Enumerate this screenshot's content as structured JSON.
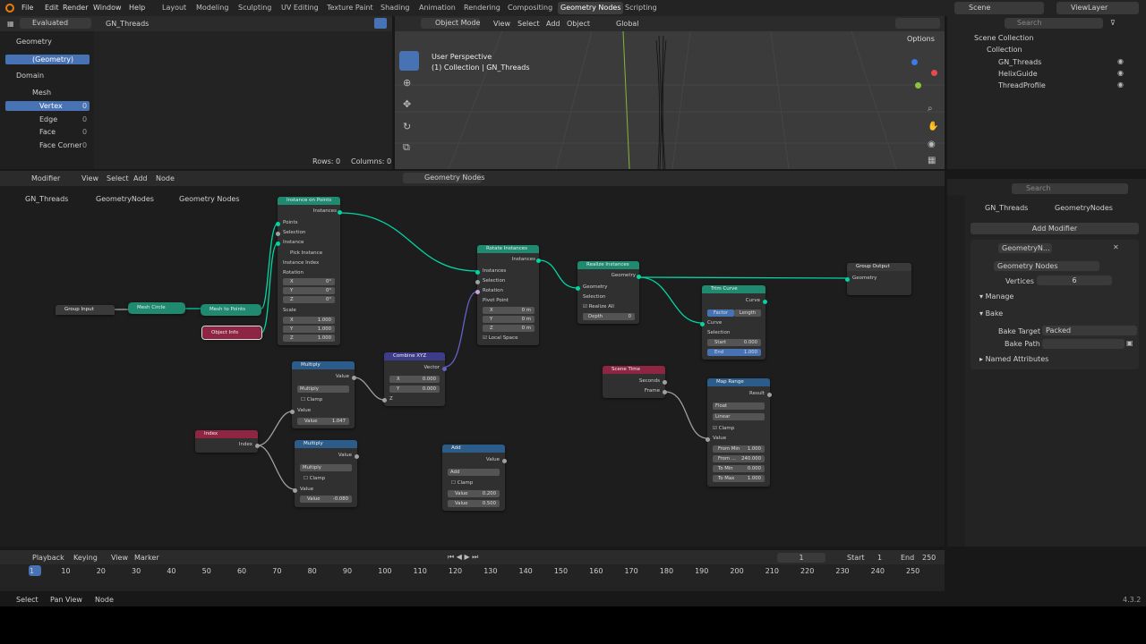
{
  "topbar": {
    "menus": [
      "File",
      "Edit",
      "Render",
      "Window",
      "Help"
    ],
    "workspaces": [
      "Layout",
      "Modeling",
      "Sculpting",
      "UV Editing",
      "Texture Paint",
      "Shading",
      "Animation",
      "Rendering",
      "Compositing",
      "Geometry Nodes",
      "Scripting"
    ],
    "active_workspace": "Geometry Nodes",
    "scene": "Scene",
    "view_layer": "ViewLayer"
  },
  "spreadsheet": {
    "mode": "Evaluated",
    "object": "GN_Threads",
    "tree": [
      "Geometry",
      "(Geometry)",
      "Domain",
      "Mesh",
      "Vertex",
      "Edge",
      "Face",
      "Face Corner"
    ],
    "counts": [
      "0",
      "0",
      "0",
      "0"
    ],
    "rows": "Rows: 0",
    "columns": "Columns: 0"
  },
  "viewport": {
    "mode": "Object Mode",
    "menus": [
      "View",
      "Select",
      "Add",
      "Object"
    ],
    "orientation": "Global",
    "title": "User Perspective",
    "subtitle": "(1) Collection | GN_Threads",
    "options": "Options"
  },
  "outliner": {
    "search": "Search",
    "items": [
      "Scene Collection",
      "Collection",
      "GN_Threads",
      "HelixGuide",
      "ThreadProfile"
    ]
  },
  "node_editor": {
    "editor": "Modifier",
    "menus": [
      "View",
      "Select",
      "Add",
      "Node"
    ],
    "tree_name": "Geometry Nodes",
    "breadcrumb": [
      "GN_Threads",
      "GeometryNodes",
      "Geometry Nodes"
    ]
  },
  "nodes": {
    "group_input": {
      "title": "Group Input"
    },
    "mesh_circle": {
      "title": "Mesh Circle"
    },
    "mesh_to_points": {
      "title": "Mesh to Points"
    },
    "object_info": {
      "title": "Object Info"
    },
    "instance_on_points": {
      "title": "Instance on Points",
      "out": "Instances",
      "rows": [
        "Points",
        "Selection",
        "Instance",
        "Pick Instance",
        "Instance Index",
        "Rotation"
      ],
      "rot": [
        "X",
        "0°",
        "Y",
        "0°",
        "Z",
        "0°"
      ],
      "scale": "Scale",
      "sc": [
        "X",
        "1.000",
        "Y",
        "1.000",
        "Z",
        "1.000"
      ]
    },
    "rotate_instances": {
      "title": "Rotate Instances",
      "out": "Instances",
      "rows": [
        "Instances",
        "Selection",
        "Rotation",
        "Pivot Point"
      ],
      "piv": [
        "X",
        "0 m",
        "Y",
        "0 m",
        "Z",
        "0 m"
      ],
      "local": "Local Space"
    },
    "realize_instances": {
      "title": "Realize Instances",
      "out": "Geometry",
      "rows": [
        "Geometry",
        "Selection"
      ],
      "realize": "Realize All",
      "depth": "Depth",
      "depth_val": "0"
    },
    "group_output": {
      "title": "Group Output",
      "in": "Geometry"
    },
    "trim_curve": {
      "title": "Trim Curve",
      "out": "Curve",
      "mode_a": "Factor",
      "mode_b": "Length",
      "rows": [
        "Curve",
        "Selection"
      ],
      "start": "Start",
      "start_val": "0.000",
      "end": "End",
      "end_val": "1.000"
    },
    "multiply1": {
      "title": "Multiply",
      "out": "Value",
      "op": "Multiply",
      "clamp": "Clamp",
      "in": "Value",
      "val_label": "Value",
      "val": "1.047"
    },
    "combine_xyz": {
      "title": "Combine XYZ",
      "out": "Vector",
      "x": "X",
      "xv": "0.000",
      "y": "Y",
      "yv": "0.000",
      "z": "Z"
    },
    "index": {
      "title": "Index",
      "out": "Index"
    },
    "multiply2": {
      "title": "Multiply",
      "out": "Value",
      "op": "Multiply",
      "clamp": "Clamp",
      "in": "Value",
      "val_label": "Value",
      "val": "-0.080"
    },
    "add": {
      "title": "Add",
      "out": "Value",
      "op": "Add",
      "clamp": "Clamp",
      "v1l": "Value",
      "v1": "0.200",
      "v2l": "Value",
      "v2": "0.500"
    },
    "scene_time": {
      "title": "Scene Time",
      "out1": "Seconds",
      "out2": "Frame"
    },
    "map_range": {
      "title": "Map Range",
      "out": "Result",
      "dtype": "Float",
      "interp": "Linear",
      "clamp": "Clamp",
      "in": "Value",
      "fmin": "From Min",
      "fminv": "1.000",
      "fmax": "From ...",
      "fmaxv": "240.000",
      "tmin": "To Min",
      "tminv": "0.000",
      "tmax": "To Max",
      "tmaxv": "1.000"
    }
  },
  "properties": {
    "search": "Search",
    "breadcrumb": [
      "GN_Threads",
      "GeometryNodes"
    ],
    "add_modifier": "Add Modifier",
    "modifier_name": "GeometryN...",
    "node_group": "Geometry Nodes",
    "vertices_label": "Vertices",
    "vertices_value": "6",
    "sections": [
      "Manage",
      "Bake"
    ],
    "bake_target_label": "Bake Target",
    "bake_target": "Packed",
    "bake_path_label": "Bake Path",
    "named_attributes": "Named Attributes"
  },
  "timeline": {
    "menus": [
      "Playback",
      "Keying",
      "View",
      "Marker"
    ],
    "frame": "1",
    "start_label": "Start",
    "start": "1",
    "end_label": "End",
    "end": "250",
    "ticks": [
      "1",
      "10",
      "20",
      "30",
      "40",
      "50",
      "60",
      "70",
      "80",
      "90",
      "100",
      "110",
      "120",
      "130",
      "140",
      "150",
      "160",
      "170",
      "180",
      "190",
      "200",
      "210",
      "220",
      "230",
      "240",
      "250"
    ]
  },
  "statusbar": {
    "items": [
      "Select",
      "Pan View",
      "Node"
    ],
    "version": "4.3.2"
  }
}
